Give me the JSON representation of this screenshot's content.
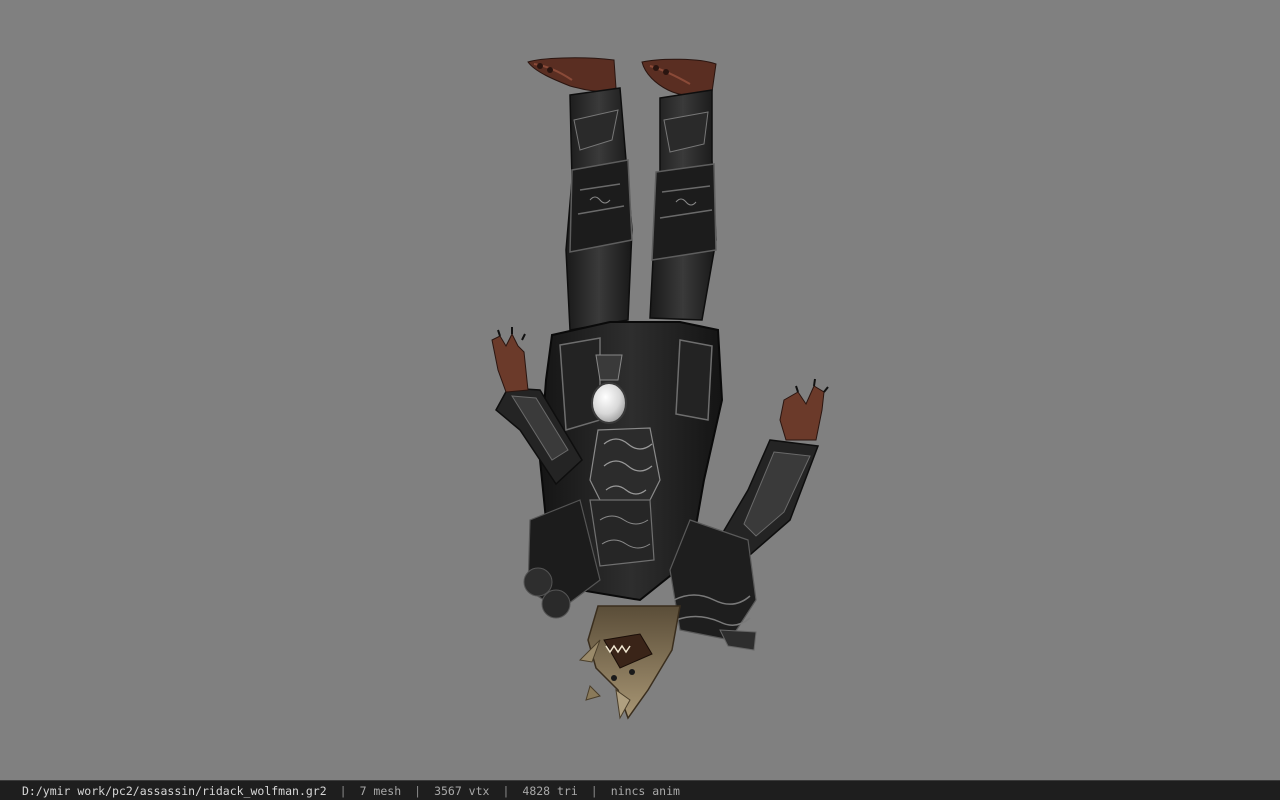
{
  "viewer": {
    "background_color": "#808080",
    "model_icon": "upside-down-wolfman-model",
    "model_colors": {
      "armor": "#1d1d1d",
      "armor_highlight": "#6a6a6a",
      "skin": "#6b3a2a",
      "fur": "#8a7a5a",
      "gem": "#e8e8e8"
    }
  },
  "status_bar": {
    "file_path": "D:/ymir work/pc2/assassin/ridack_wolfman.gr2",
    "separator": "|",
    "mesh_count": "7 mesh",
    "vertex_count": "3567 vtx",
    "triangle_count": "4828 tri",
    "anim_status": "nincs anim"
  }
}
